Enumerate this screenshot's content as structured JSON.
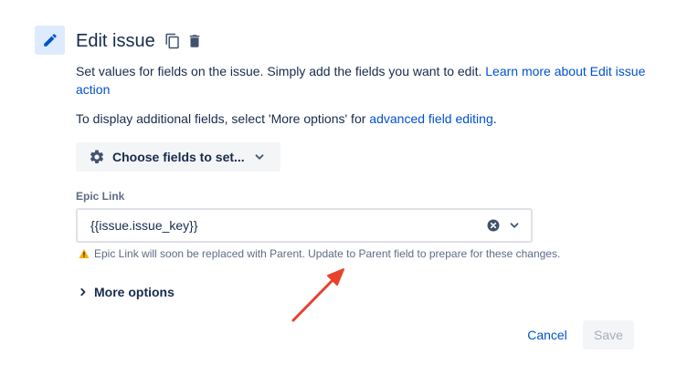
{
  "header": {
    "title": "Edit issue",
    "action_icon": "pencil-icon",
    "copy_icon": "copy-icon",
    "delete_icon": "trash-icon"
  },
  "description": {
    "line1": "Set values for fields on the issue. Simply add the fields you want to edit.",
    "learn_more_link": "Learn more about Edit issue action",
    "line2_prefix": "To display additional fields, select 'More options' for",
    "advanced_link": "advanced field editing",
    "line2_suffix": "."
  },
  "choose_fields_button": {
    "label": "Choose fields to set...",
    "icon": "gear-icon"
  },
  "epic_link_field": {
    "label": "Epic Link",
    "value": "{{issue.issue_key}}",
    "warning": "Epic Link will soon be replaced with Parent. Update to Parent field to prepare for these changes."
  },
  "more_options": {
    "label": "More options"
  },
  "footer": {
    "cancel_label": "Cancel",
    "save_label": "Save"
  },
  "colors": {
    "link": "#0052cc",
    "text": "#172b4d",
    "muted": "#5e6c84",
    "icon_bg": "#deebff",
    "warning": "#ffab00",
    "annotation_arrow": "#e8412c"
  }
}
